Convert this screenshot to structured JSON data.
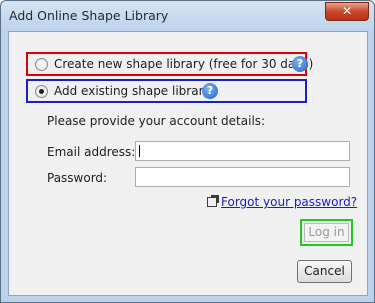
{
  "window": {
    "title": "Add Online Shape Library",
    "close_glyph": "✕"
  },
  "options": {
    "create_new_label": "Create new shape library (free for 30 days)",
    "create_new_selected": false,
    "add_existing_label": "Add existing shape library",
    "add_existing_selected": true,
    "help_glyph": "?"
  },
  "account": {
    "instructions": "Please provide your account details:",
    "email_label": "Email address:",
    "email_value": "",
    "password_label": "Password:",
    "password_value": ""
  },
  "links": {
    "forgot_password": "Forgot your password?"
  },
  "buttons": {
    "login_label": "Log in",
    "login_enabled": false,
    "cancel_label": "Cancel"
  },
  "colors": {
    "highlight_create_new": "#dd0000",
    "highlight_add_existing": "#1a1ec6",
    "highlight_login": "#22c822",
    "link": "#1a1ec6"
  },
  "icons": {
    "help": "help-icon",
    "external_link": "external-link-icon",
    "close": "close-icon"
  }
}
